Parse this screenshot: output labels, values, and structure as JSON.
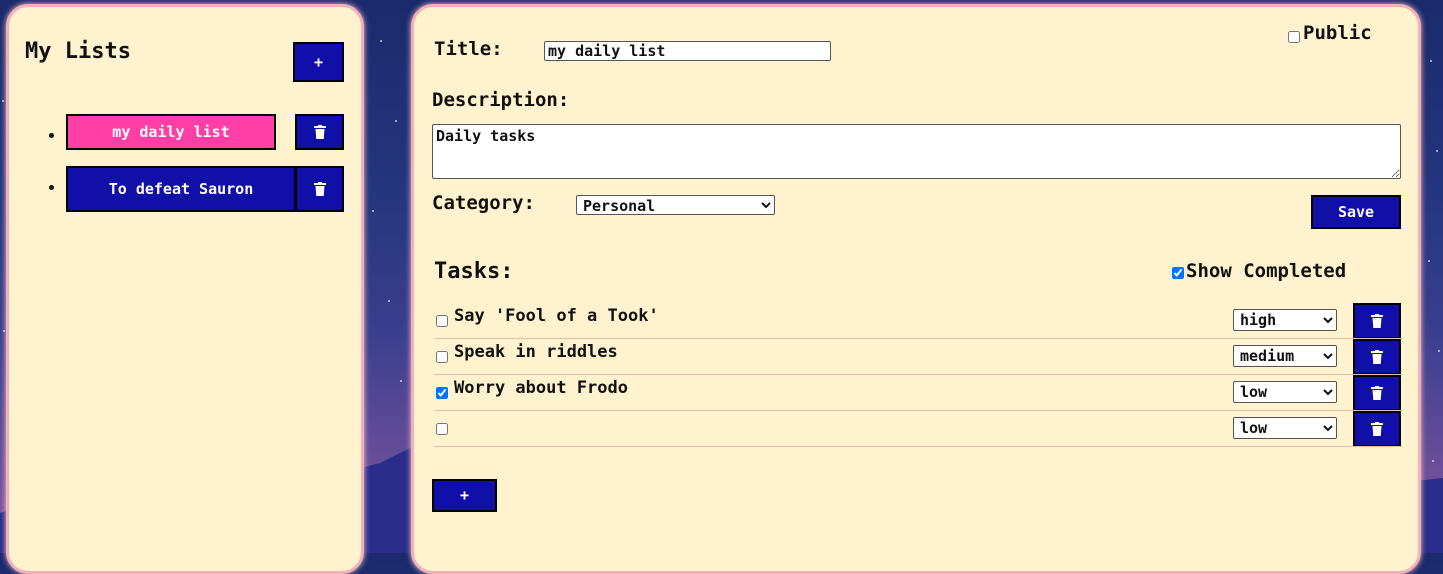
{
  "sidebar": {
    "title": "My Lists",
    "add_label": "+",
    "lists": [
      {
        "label": "my daily list",
        "active": true
      },
      {
        "label": "To defeat Sauron",
        "active": false
      }
    ]
  },
  "editor": {
    "title_label": "Title:",
    "title_value": "my daily list",
    "public_label": "Public",
    "public_checked": false,
    "description_label": "Description:",
    "description_value": "Daily tasks",
    "category_label": "Category:",
    "category_value": "Personal",
    "save_label": "Save"
  },
  "tasks": {
    "heading": "Tasks:",
    "show_completed_label": "Show Completed",
    "show_completed_checked": true,
    "priority_options": [
      "high",
      "medium",
      "low"
    ],
    "items": [
      {
        "text": "Say 'Fool of a Took'",
        "done": false,
        "priority": "high"
      },
      {
        "text": "Speak in riddles",
        "done": false,
        "priority": "medium"
      },
      {
        "text": "Worry about Frodo",
        "done": true,
        "priority": "low"
      },
      {
        "text": "",
        "done": false,
        "priority": "low"
      }
    ],
    "add_label": "+"
  },
  "colors": {
    "panel": "#fff3cf",
    "panel_border": "#f4b0b6",
    "button": "#1010a8",
    "active_button": "#ff3fa6"
  },
  "icons": {
    "delete": "trash-icon"
  }
}
